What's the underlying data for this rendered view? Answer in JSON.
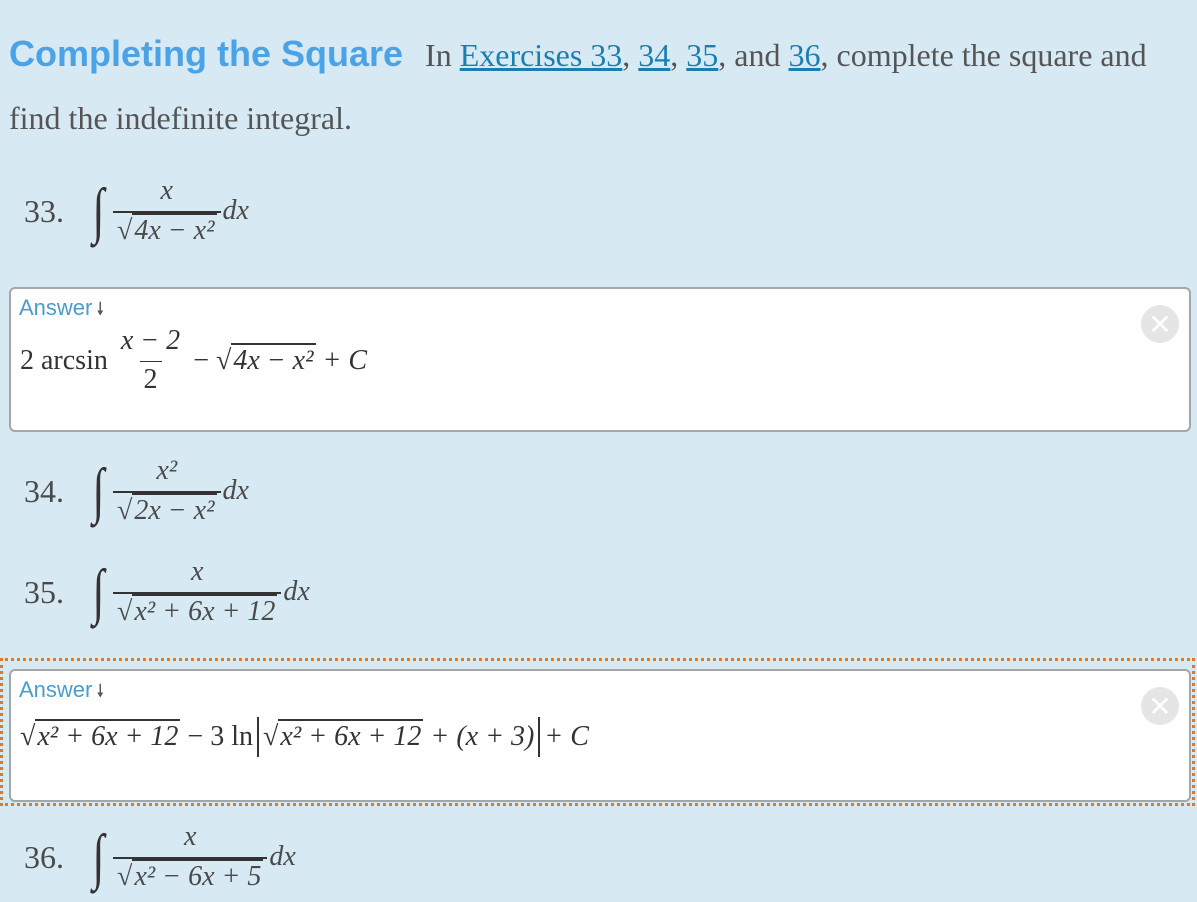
{
  "intro": {
    "heading": "Completing the Square",
    "text_in": "In",
    "links": [
      "Exercises 33",
      "34",
      "35",
      "36"
    ],
    "sep1": ",",
    "sep2": ",",
    "sep3": ", and",
    "text_after": ", complete the square and find the indefinite integral."
  },
  "exercises": [
    {
      "number": "33.",
      "numerator": "x",
      "denominator_radicand": "4x − x²",
      "differential": "dx"
    },
    {
      "number": "34.",
      "numerator": "x²",
      "denominator_radicand": "2x − x²",
      "differential": "dx"
    },
    {
      "number": "35.",
      "numerator": "x",
      "denominator_radicand": "x² + 6x + 12",
      "differential": "dx"
    },
    {
      "number": "36.",
      "numerator": "x",
      "denominator_radicand": "x² − 6x + 5",
      "differential": "dx"
    }
  ],
  "answers": [
    {
      "label": "Answer",
      "arrow_icon": "arrow-down-icon",
      "parts": {
        "coef": "2 arcsin",
        "frac_num": "x − 2",
        "frac_den": "2",
        "minus": "−",
        "radicand": "4x − x²",
        "tail": "+ C"
      }
    },
    {
      "label": "Answer",
      "arrow_icon": "arrow-down-icon",
      "parts": {
        "radicand1": "x² + 6x + 12",
        "mid": "− 3 ln",
        "radicand2": "x² + 6x + 12",
        "inner_tail": "+ (x + 3)",
        "tail": "+ C"
      }
    }
  ],
  "close_icon_glyph": "✕",
  "radical_glyph": "√",
  "integral_glyph": "∫",
  "arrow_glyph": "🠗"
}
